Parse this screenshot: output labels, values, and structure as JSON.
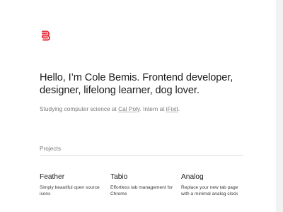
{
  "logo": {
    "icon": "b-logo-icon",
    "color": "#e8323c"
  },
  "hero": {
    "headline": "Hello, I’m Cole Bemis. Frontend developer, designer, lifelong learner, dog lover.",
    "sub_prefix": "Studying computer science at ",
    "sub_link_1": "Cal Poly",
    "sub_middle": ". Intern at ",
    "sub_link_2": "iFixit",
    "sub_suffix": "."
  },
  "projects": {
    "label": "Projects",
    "items": [
      {
        "name": "Feather",
        "description": "Simply beautiful open source icons"
      },
      {
        "name": "Tabio",
        "description": "Effortless tab management for Chrome"
      },
      {
        "name": "Analog",
        "description": "Replace your new tab page with a minimal analog clock"
      }
    ]
  }
}
